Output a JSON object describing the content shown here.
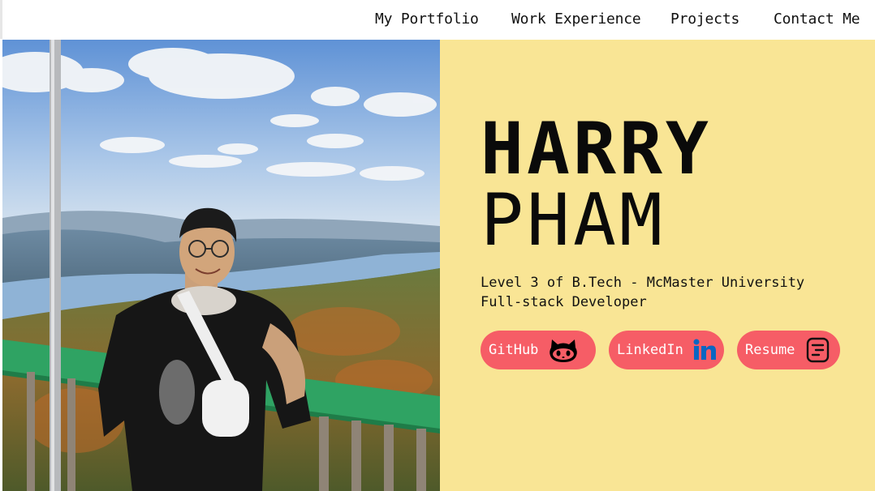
{
  "nav": {
    "items": [
      {
        "label": "My Portfolio"
      },
      {
        "label": "Work Experience"
      },
      {
        "label": "Projects"
      },
      {
        "label": "Contact Me"
      }
    ]
  },
  "hero": {
    "first_name": "HARRY",
    "last_name": "PHAM",
    "tagline_line1": "Level 3 of B.Tech - McMaster University",
    "tagline_line2": "Full-stack Developer",
    "links": {
      "github": {
        "label": "GitHub",
        "icon": "github-icon"
      },
      "linkedin": {
        "label": "LinkedIn",
        "icon": "linkedin-icon"
      },
      "resume": {
        "label": "Resume",
        "icon": "resume-icon"
      }
    }
  },
  "colors": {
    "panel_background": "#f9e595",
    "pill_background": "#f65d66",
    "linkedin_blue": "#0a66c2"
  }
}
